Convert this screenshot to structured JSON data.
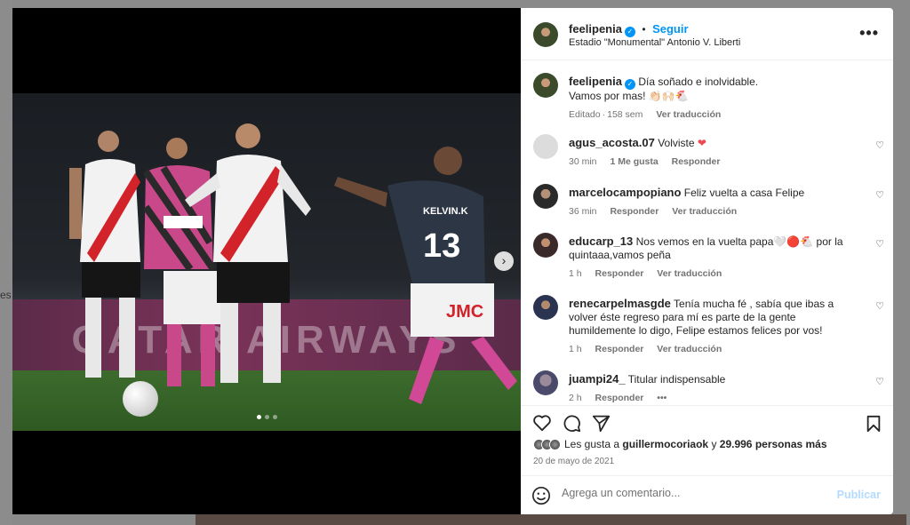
{
  "sidebar_snippet": "es",
  "post": {
    "username": "feelipenia",
    "follow_label": "Seguir",
    "location": "Estadio \"Monumental\" Antonio V. Liberti",
    "more_label": "•••"
  },
  "photo": {
    "ad_text": "QATAR AIRWAYS",
    "jersey_number": "13",
    "jersey_name": "KELVIN.K",
    "sponsor": "JMC"
  },
  "caption": {
    "username": "feelipenia",
    "line1": "Día soñado e inolvidable.",
    "line2": "Vamos por mas! 👏🏻🙌🏻🐔",
    "edited": "Editado",
    "age": "158 sem",
    "translate": "Ver traducción"
  },
  "comments": [
    {
      "username": "agus_acosta.07",
      "text": "Volviste",
      "time": "30 min",
      "likes": "1 Me gusta",
      "reply": "Responder",
      "translate": ""
    },
    {
      "username": "marcelocampopiano",
      "text": "Feliz vuelta a casa Felipe",
      "time": "36 min",
      "likes": "",
      "reply": "Responder",
      "translate": "Ver traducción"
    },
    {
      "username": "educarp_13",
      "text": "Nos vemos en la vuelta papa🤍🔴🐔 por la quintaaa,vamos peña",
      "time": "1 h",
      "likes": "",
      "reply": "Responder",
      "translate": "Ver traducción"
    },
    {
      "username": "renecarpelmasgde",
      "text": "Tenía mucha fé , sabía que ibas a volver éste regreso para mí es parte de la gente humildemente lo digo, Felipe estamos felices por vos!",
      "time": "1 h",
      "likes": "",
      "reply": "Responder",
      "translate": "Ver traducción"
    },
    {
      "username": "juampi24_",
      "text": "Titular indispensable",
      "time": "2 h",
      "likes": "",
      "reply": "Responder",
      "translate": "•••"
    }
  ],
  "likes": {
    "prefix": "Les gusta a",
    "user": "guillermocoriaok",
    "connector": "y",
    "others": "29.996 personas más"
  },
  "date": "20 de mayo de 2021",
  "add_comment": {
    "placeholder": "Agrega un comentario...",
    "publish": "Publicar"
  },
  "colors": {
    "accent": "#0095f6",
    "heart": "#ed4956",
    "publish_disabled": "#b3dbff"
  }
}
